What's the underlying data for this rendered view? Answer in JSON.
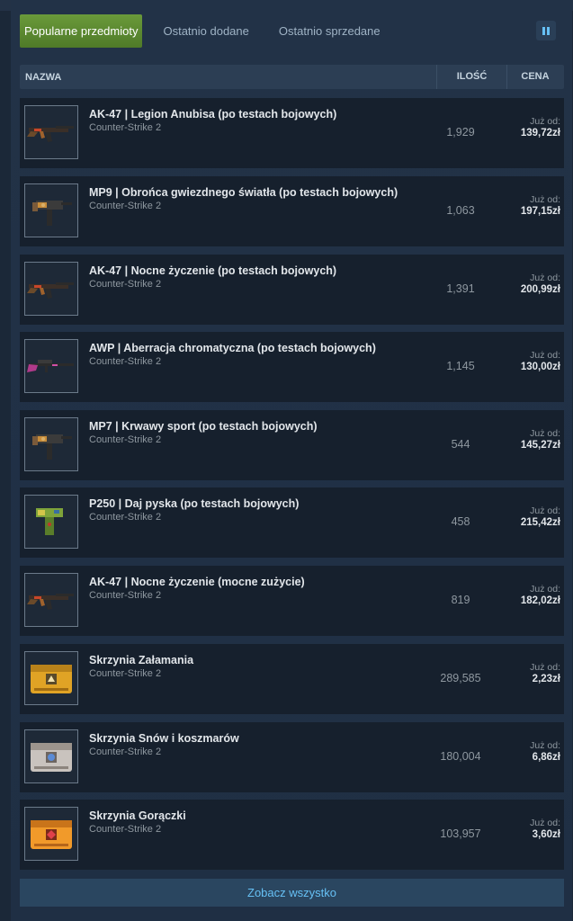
{
  "tabs": [
    {
      "label": "Popularne przedmioty",
      "active": true
    },
    {
      "label": "Ostatnio dodane",
      "active": false
    },
    {
      "label": "Ostatnio sprzedane",
      "active": false
    }
  ],
  "pause_icon": "pause-icon",
  "table_header": {
    "name": "NAZWA",
    "quantity": "ILOŚĆ",
    "price": "CENA"
  },
  "items": [
    {
      "name": "AK-47 | Legion Anubisa (po testach bojowych)",
      "game": "Counter-Strike 2",
      "quantity": "1,929",
      "price_label": "Już od:",
      "price": "139,72zł",
      "icon": "rifle-icon"
    },
    {
      "name": "MP9 | Obrońca gwiezdnego światła (po testach bojowych)",
      "game": "Counter-Strike 2",
      "quantity": "1,063",
      "price_label": "Już od:",
      "price": "197,15zł",
      "icon": "smg-icon"
    },
    {
      "name": "AK-47 | Nocne życzenie (po testach bojowych)",
      "game": "Counter-Strike 2",
      "quantity": "1,391",
      "price_label": "Już od:",
      "price": "200,99zł",
      "icon": "rifle-icon"
    },
    {
      "name": "AWP | Aberracja chromatyczna (po testach bojowych)",
      "game": "Counter-Strike 2",
      "quantity": "1,145",
      "price_label": "Już od:",
      "price": "130,00zł",
      "icon": "sniper-icon"
    },
    {
      "name": "MP7 | Krwawy sport (po testach bojowych)",
      "game": "Counter-Strike 2",
      "quantity": "544",
      "price_label": "Już od:",
      "price": "145,27zł",
      "icon": "smg-icon"
    },
    {
      "name": "P250 | Daj pyska (po testach bojowych)",
      "game": "Counter-Strike 2",
      "quantity": "458",
      "price_label": "Już od:",
      "price": "215,42zł",
      "icon": "pistol-icon"
    },
    {
      "name": "AK-47 | Nocne życzenie (mocne zużycie)",
      "game": "Counter-Strike 2",
      "quantity": "819",
      "price_label": "Już od:",
      "price": "182,02zł",
      "icon": "rifle-icon"
    },
    {
      "name": "Skrzynia Załamania",
      "game": "Counter-Strike 2",
      "quantity": "289,585",
      "price_label": "Już od:",
      "price": "2,23zł",
      "icon": "case-icon"
    },
    {
      "name": "Skrzynia Snów i koszmarów",
      "game": "Counter-Strike 2",
      "quantity": "180,004",
      "price_label": "Już od:",
      "price": "6,86zł",
      "icon": "case-icon"
    },
    {
      "name": "Skrzynia Gorączki",
      "game": "Counter-Strike 2",
      "quantity": "103,957",
      "price_label": "Już od:",
      "price": "3,60zł",
      "icon": "case-icon"
    }
  ],
  "see_all_label": "Zobacz wszystko"
}
